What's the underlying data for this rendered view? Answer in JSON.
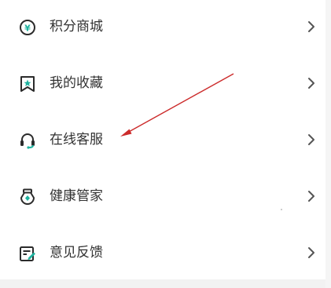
{
  "menu": {
    "items": [
      {
        "label": "积分商城",
        "icon": "points-mall-icon"
      },
      {
        "label": "我的收藏",
        "icon": "bookmark-icon"
      },
      {
        "label": "在线客服",
        "icon": "headset-icon"
      },
      {
        "label": "健康管家",
        "icon": "health-manager-icon"
      },
      {
        "label": "意见反馈",
        "icon": "feedback-icon"
      }
    ]
  },
  "annotation": {
    "arrow_color": "#cc2b2b"
  },
  "colors": {
    "icon_dark": "#2b2b2b",
    "icon_accent": "#1fb3a0",
    "text": "#333333",
    "chevron": "#555555"
  }
}
